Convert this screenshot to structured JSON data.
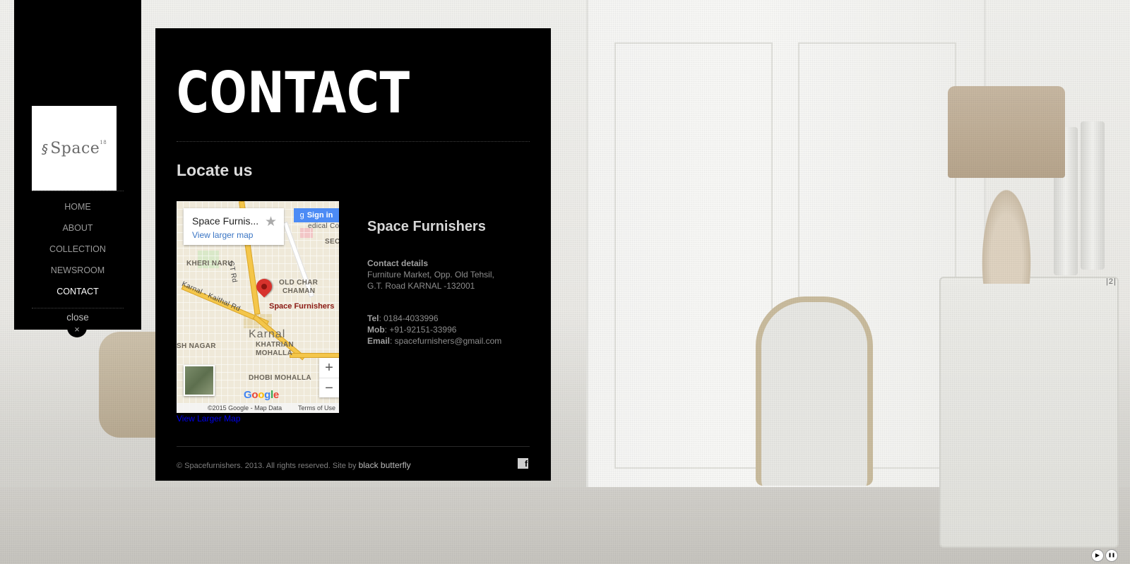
{
  "sidebar": {
    "logo_text": "Space",
    "logo_sup": "18",
    "nav": [
      {
        "label": "HOME"
      },
      {
        "label": "ABOUT"
      },
      {
        "label": "COLLECTION"
      },
      {
        "label": "NEWSROOM"
      },
      {
        "label": "CONTACT"
      }
    ],
    "close_label": "close",
    "close_icon": "×"
  },
  "main": {
    "title": "CONTACT",
    "section_heading": "Locate us",
    "map": {
      "place_name": "Space Furnis...",
      "larger_map_link": "View larger map",
      "sign_in": "Sign in",
      "pin_label": "Space Furnishers",
      "copyright": "©2015 Google - Map Data",
      "terms": "Terms of Use",
      "labels": {
        "medical": "edical College",
        "kheri": "KHERI NARU",
        "gt_road": "GT Rd",
        "old_char": "OLD CHAR",
        "chaman": "CHAMAN",
        "karnal_kaithal": "Karnal - Kaithal Rd",
        "karnal": "Karnal",
        "sh_nagar": "SH NAGAR",
        "khatrian": "KHATRIAN",
        "mohalla": "MOHALLA",
        "dhobi": "DHOBI MOHALLA",
        "sec": "SEC"
      },
      "google": [
        "G",
        "o",
        "o",
        "g",
        "l",
        "e"
      ]
    },
    "view_larger_map": "View Larger Map",
    "company_name": "Space Furnishers",
    "contact": {
      "details_label": "Contact details",
      "address_line1": "Furniture Market, Opp. Old Tehsil,",
      "address_line2": "G.T. Road KARNAL -132001",
      "tel_label": "Tel",
      "tel": ": 0184-4033996",
      "mob_label": "Mob",
      "mob": ": +91-92151-33996",
      "email_label": "Email",
      "email": ": spacefurnishers@gmail.com"
    },
    "footer": {
      "copyright": "© Spacefurnishers. 2013. All rights reserved. Site by ",
      "credit_link": "black butterfly",
      "facebook_glyph": "f"
    }
  },
  "slideshow": {
    "counter": "|2|",
    "play_glyph": "▶",
    "pause_glyph": "❚❚"
  }
}
